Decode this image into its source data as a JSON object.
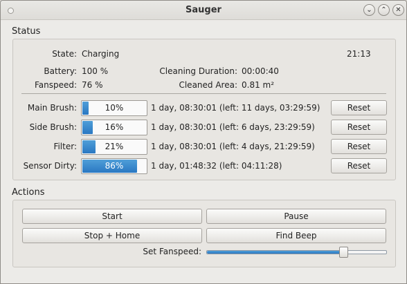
{
  "window": {
    "title": "Sauger",
    "buttons": {
      "minimize": "⌄",
      "maximize": "⌃",
      "close": "✕"
    }
  },
  "status": {
    "section_label": "Status",
    "state_label": "State:",
    "state_value": "Charging",
    "time": "21:13",
    "battery_label": "Battery:",
    "battery_value": "100 %",
    "cleaning_duration_label": "Cleaning Duration:",
    "cleaning_duration_value": "00:00:40",
    "fanspeed_label": "Fanspeed:",
    "fanspeed_value": "76 %",
    "cleaned_area_label": "Cleaned Area:",
    "cleaned_area_value": "0.81 m²"
  },
  "consumables": [
    {
      "label": "Main Brush:",
      "percent_text": "10%",
      "percent": 10,
      "duration": "1 day, 08:30:01 (left: 11 days, 03:29:59)",
      "reset": "Reset"
    },
    {
      "label": "Side Brush:",
      "percent_text": "16%",
      "percent": 16,
      "duration": "1 day, 08:30:01 (left: 6 days, 23:29:59)",
      "reset": "Reset"
    },
    {
      "label": "Filter:",
      "percent_text": "21%",
      "percent": 21,
      "duration": "1 day, 08:30:01 (left: 4 days, 21:29:59)",
      "reset": "Reset"
    },
    {
      "label": "Sensor Dirty:",
      "percent_text": "86%",
      "percent": 86,
      "duration": "1 day, 01:48:32 (left: 04:11:28)",
      "reset": "Reset"
    }
  ],
  "actions": {
    "section_label": "Actions",
    "start": "Start",
    "pause": "Pause",
    "stop_home": "Stop + Home",
    "find_beep": "Find Beep",
    "set_fanspeed_label": "Set Fanspeed:",
    "fanspeed_slider_percent": 76
  },
  "colors": {
    "accent": "#3a8ad0"
  }
}
